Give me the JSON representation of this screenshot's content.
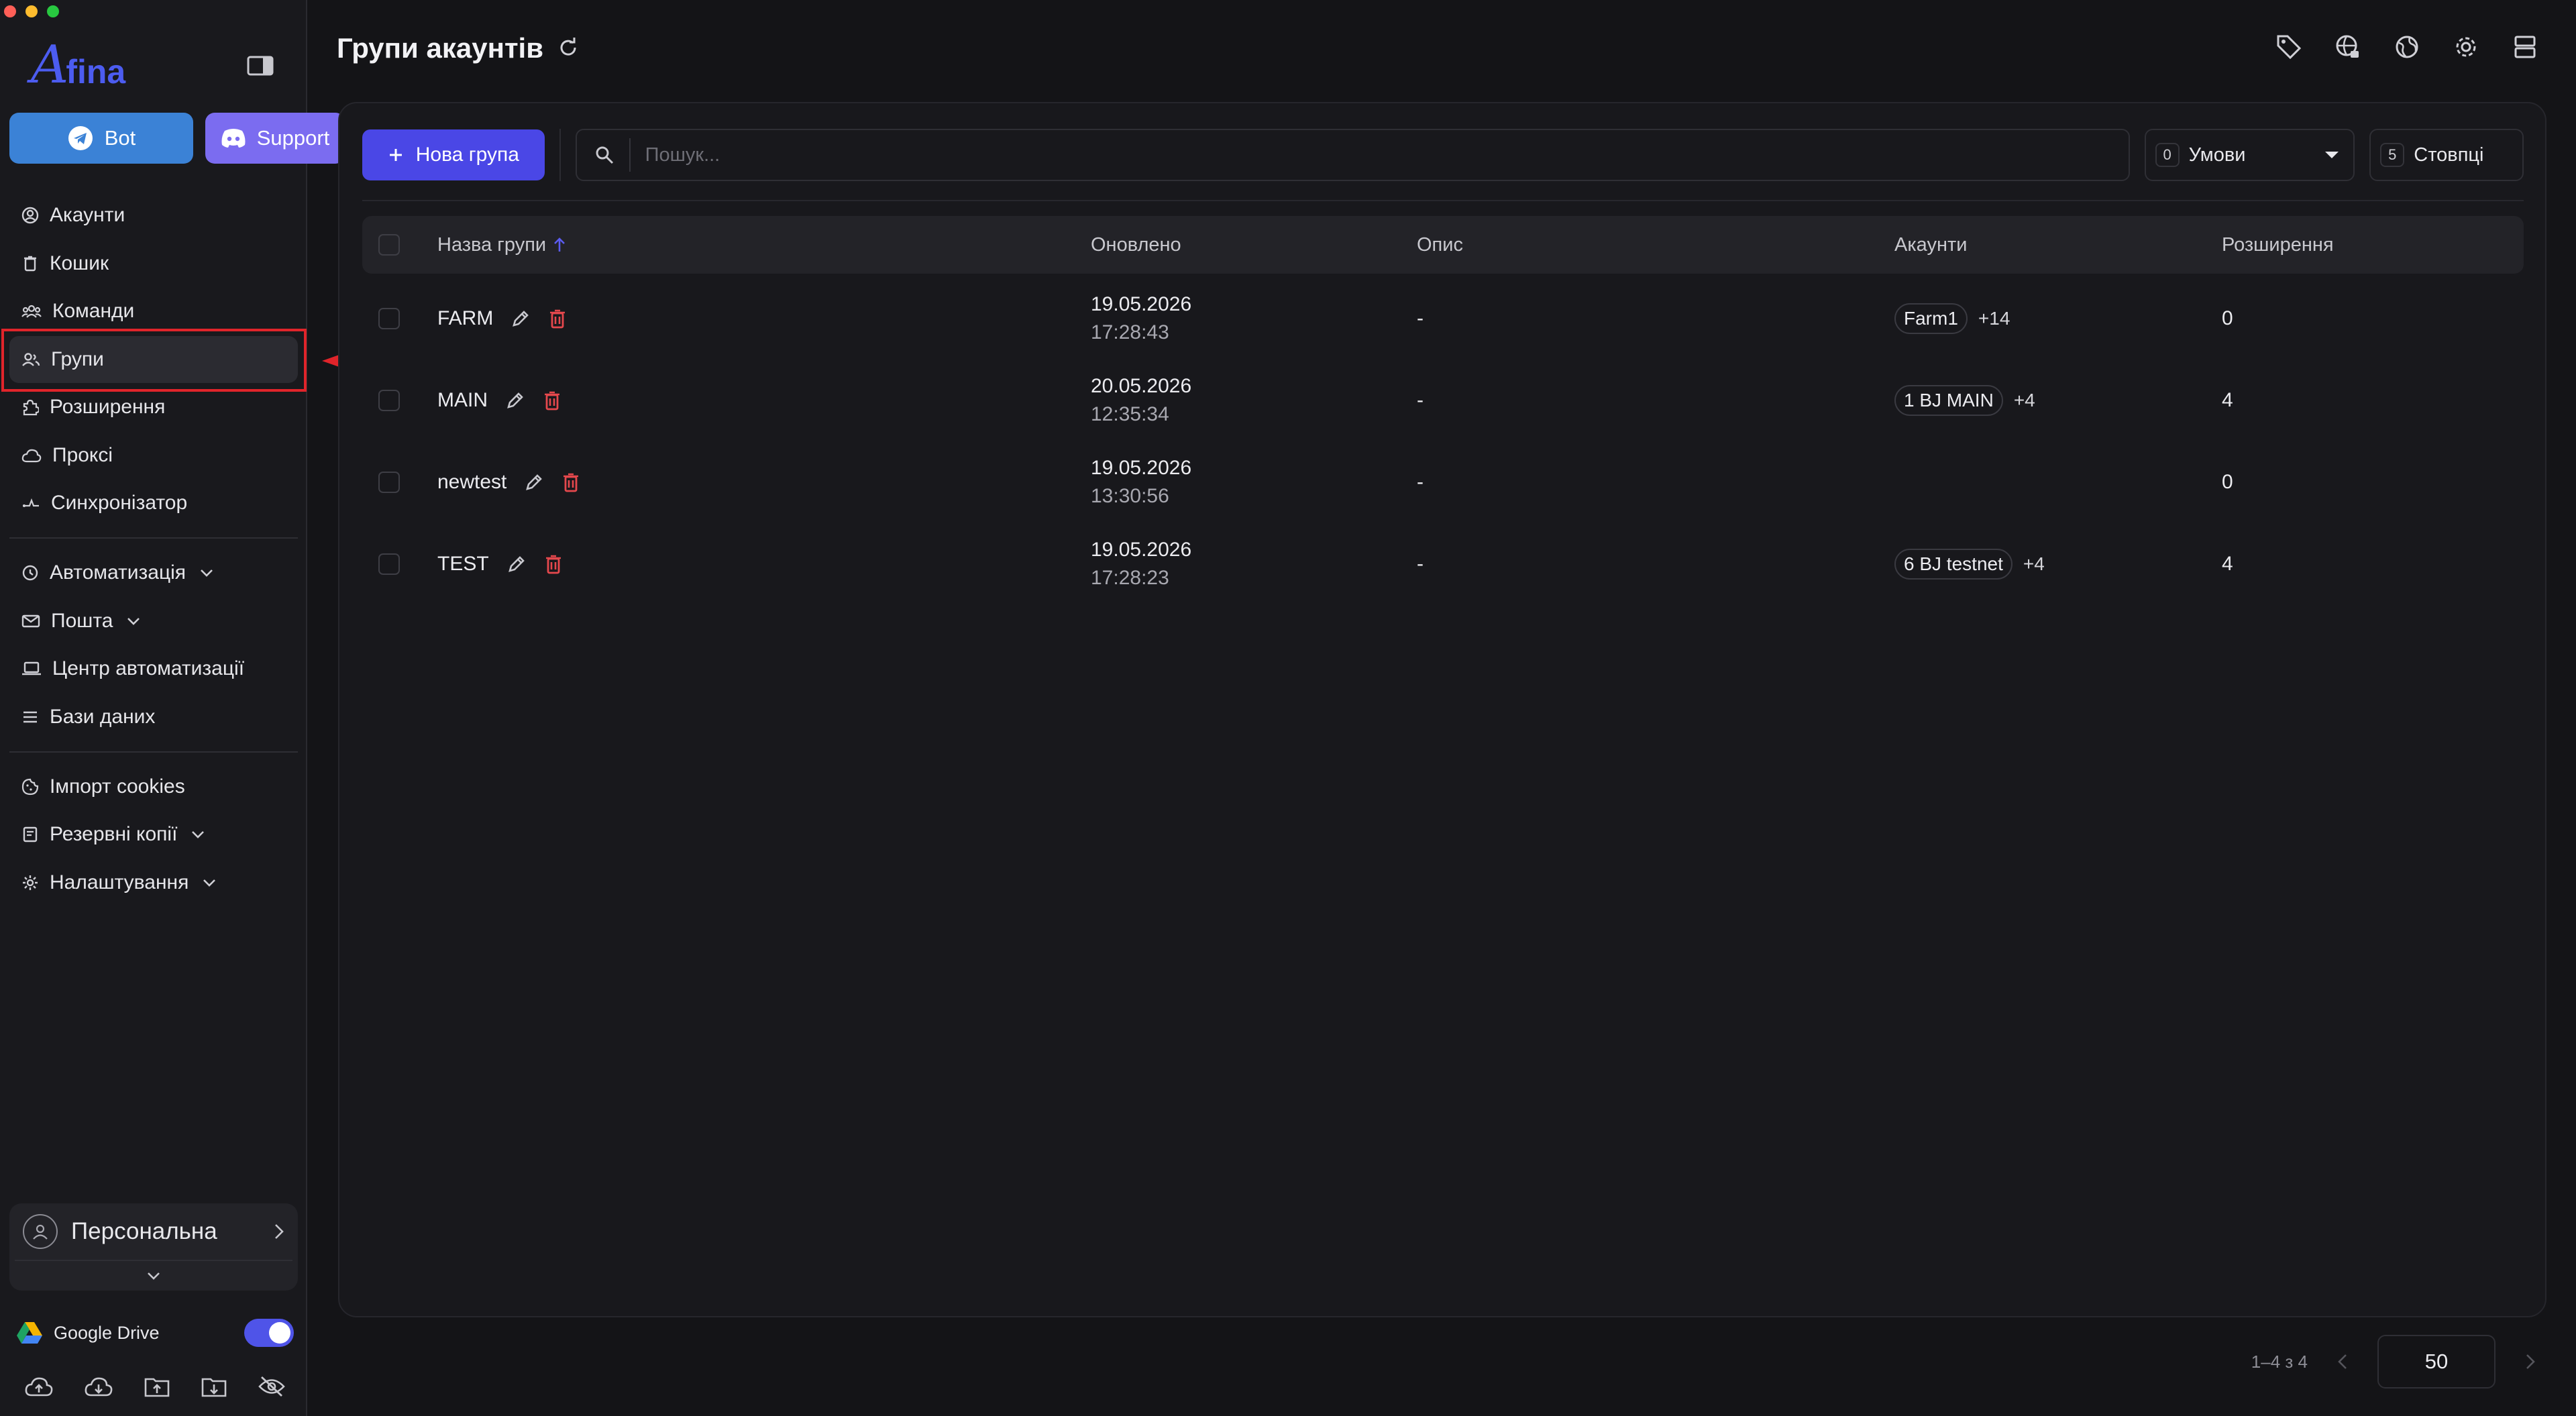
{
  "app": {
    "logo_text": "Afina"
  },
  "sidebar": {
    "bot_label": "Bot",
    "support_label": "Support",
    "items": [
      {
        "label": "Акаунти",
        "icon": "user-circle-icon"
      },
      {
        "label": "Кошик",
        "icon": "trash-icon"
      },
      {
        "label": "Команди",
        "icon": "team-icon"
      },
      {
        "label": "Групи",
        "icon": "users-icon",
        "active": true
      },
      {
        "label": "Розширення",
        "icon": "puzzle-icon"
      },
      {
        "label": "Проксі",
        "icon": "cloud-icon"
      },
      {
        "label": "Синхронізатор",
        "icon": "sync-icon"
      }
    ],
    "items2": [
      {
        "label": "Автоматизація",
        "icon": "automation-icon"
      },
      {
        "label": "Пошта",
        "icon": "mail-icon"
      },
      {
        "label": "Центр автоматизації",
        "icon": "laptop-icon"
      },
      {
        "label": "Бази даних",
        "icon": "list-icon"
      }
    ],
    "items3": [
      {
        "label": "Імпорт cookies",
        "icon": "cookie-icon"
      },
      {
        "label": "Резервні копії",
        "icon": "backup-icon"
      },
      {
        "label": "Налаштування",
        "icon": "gear-icon"
      }
    ],
    "workspace": "Персональна",
    "google_drive_label": "Google Drive",
    "google_drive_enabled": true
  },
  "header": {
    "title": "Групи акаунтів"
  },
  "toolbar": {
    "new_group_label": "Нова група",
    "search_placeholder": "Пошук...",
    "conditions_count": "0",
    "conditions_label": "Умови",
    "columns_count": "5",
    "columns_label": "Стовпці"
  },
  "table": {
    "headers": {
      "name": "Назва групи",
      "updated": "Оновлено",
      "description": "Опис",
      "accounts": "Акаунти",
      "extensions": "Розширення"
    },
    "rows": [
      {
        "name": "FARM",
        "date": "19.05.2026",
        "time": "17:28:43",
        "description": "-",
        "account_chip": "Farm1",
        "account_more": "+14",
        "extensions": "0"
      },
      {
        "name": "MAIN",
        "date": "20.05.2026",
        "time": "12:35:34",
        "description": "-",
        "account_chip": "1 BJ MAIN",
        "account_more": "+4",
        "extensions": "4"
      },
      {
        "name": "newtest",
        "date": "19.05.2026",
        "time": "13:30:56",
        "description": "-",
        "account_chip": "",
        "account_more": "",
        "extensions": "0"
      },
      {
        "name": "TEST",
        "date": "19.05.2026",
        "time": "17:28:23",
        "description": "-",
        "account_chip": "6 BJ testnet",
        "account_more": "+4",
        "extensions": "4"
      }
    ]
  },
  "pagination": {
    "range": "1–4 з 4",
    "page_size": "50"
  },
  "colors": {
    "accent": "#4a47e6",
    "danger": "#e5484d",
    "annotation": "#e0242a"
  }
}
